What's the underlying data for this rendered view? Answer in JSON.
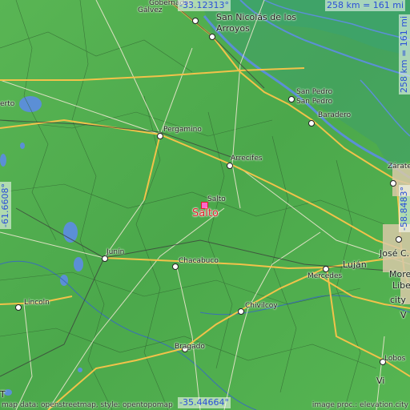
{
  "coords": {
    "top_lat": "-33.12313°",
    "bottom_lat": "-35.44664°",
    "left_lon": "-61.6608°",
    "right_lon": "-58.8483°",
    "scale_top": "258 km = 161 mi",
    "scale_right": "258 km = 161 mi"
  },
  "main_city": {
    "label": "Salto",
    "small_label": "Salto"
  },
  "cities": [
    {
      "id": "galvez",
      "label": "Gálvez"
    },
    {
      "id": "gobernador",
      "label": "Gobernador"
    },
    {
      "id": "san-nicolas",
      "label": "San Nicolás de los"
    },
    {
      "id": "arroyos",
      "label": "Arroyos"
    },
    {
      "id": "san-pedro",
      "label": "San Pedro"
    },
    {
      "id": "san-pedro-2",
      "label": "San Pedro"
    },
    {
      "id": "baradero",
      "label": "Baradero"
    },
    {
      "id": "pergamino",
      "label": "Pergamino"
    },
    {
      "id": "arrecifes",
      "label": "Arrecifes"
    },
    {
      "id": "zarate",
      "label": "Zárate"
    },
    {
      "id": "erto",
      "label": "erto"
    },
    {
      "id": "junin",
      "label": "Junín"
    },
    {
      "id": "chacabuco",
      "label": "Chacabuco"
    },
    {
      "id": "mercedes",
      "label": "Mercedes"
    },
    {
      "id": "lujan",
      "label": "Luján"
    },
    {
      "id": "jose-c-paz",
      "label": "José C. Pa"
    },
    {
      "id": "moreno",
      "label": "Moren"
    },
    {
      "id": "liber",
      "label": "Liber"
    },
    {
      "id": "city",
      "label": "city"
    },
    {
      "id": "lincoln",
      "label": "Lincoln"
    },
    {
      "id": "chivilcoy",
      "label": "Chivilcoy"
    },
    {
      "id": "bragado",
      "label": "Bragado"
    },
    {
      "id": "lobos",
      "label": "Lobos"
    },
    {
      "id": "v1",
      "label": "V"
    },
    {
      "id": "v2",
      "label": "Vi"
    },
    {
      "id": "t-left",
      "label": "T"
    }
  ],
  "attribution_left": "map data: openstreetmap, style: opentopomap",
  "attribution_right": "image proc.: elevation.city",
  "colors": {
    "land": "#4fae4c",
    "water": "#5b8fd6",
    "river_delta": "#3a9e6a",
    "road_major": "#f2c24a",
    "road_minor": "#e9e5d2",
    "boundary": "#2f5f2f",
    "coord_text": "#2a4fd8",
    "main_city": "#e0202a"
  }
}
